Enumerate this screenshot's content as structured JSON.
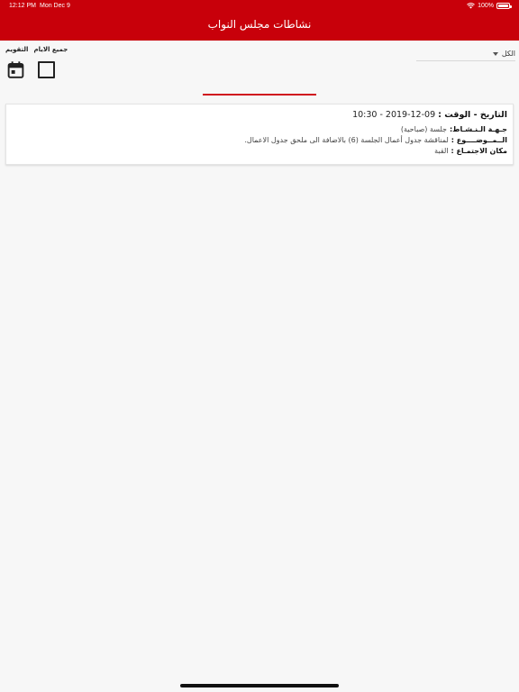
{
  "status_bar": {
    "time": "12:12 PM",
    "date": "Mon Dec 9",
    "battery": "100%"
  },
  "header": {
    "title": "نشاطات مجلس النواب"
  },
  "filter": {
    "selected": "الكل"
  },
  "view_toggle": {
    "calendar_label": "التقويم",
    "all_days_label": "جميع الايام"
  },
  "events": [
    {
      "date_label": "التاريخ - الوقت :",
      "date_value": "10:30 - 2019-12-09",
      "activity_label": "جـهـة الـنـشـاط:",
      "activity_value": "جلسة (صباحية)",
      "subject_label": "الــمــوضــــوع :",
      "subject_value": "لمناقشة جدول أعمال الجلسة (6) بالاضافة الى ملحق جدول الاعمال.",
      "venue_label": "مكان الاجتمـاع :",
      "venue_value": "القبة"
    }
  ],
  "colors": {
    "header_bg": "#c8000a",
    "accent": "#d0141e"
  }
}
